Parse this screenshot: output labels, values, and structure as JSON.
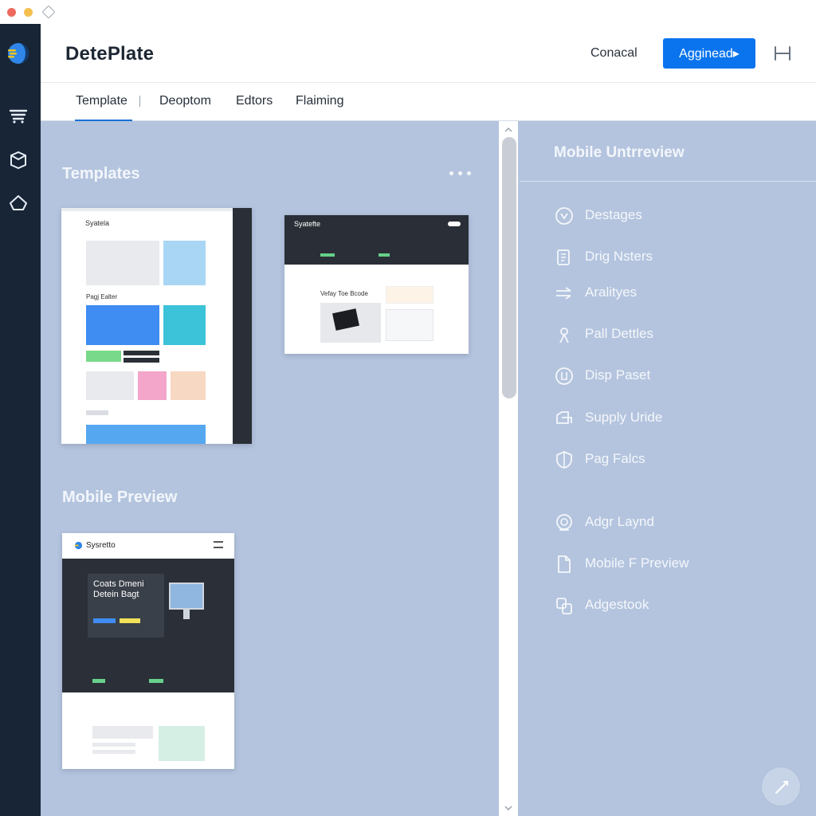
{
  "app": {
    "title": "DetePlate"
  },
  "header": {
    "cancel_label": "Conacal",
    "primary_label": "Agginead▸"
  },
  "tabs": [
    {
      "label": "Template",
      "active": true
    },
    {
      "label": "Deoptom"
    },
    {
      "label": "Edtors"
    },
    {
      "label": "Flaiming"
    }
  ],
  "templates": {
    "title": "Templates",
    "card1": {
      "brand": "Syatela",
      "section": "Pagj Ealter"
    },
    "card2": {
      "brand": "Syatefte",
      "headline": "Vefay Toe Bcode"
    }
  },
  "mobile_preview": {
    "title": "Mobile Preview",
    "brand": "Sysretto",
    "headline_1": "Coats Dmeni",
    "headline_2": "Detein Bagt"
  },
  "right_panel": {
    "title": "Mobile Untrreview",
    "items": [
      {
        "label": "Destages",
        "icon": "shield-icon"
      },
      {
        "label": "Drig Nsters",
        "icon": "document-icon"
      },
      {
        "label": "Aralityes",
        "icon": "arrows-icon"
      },
      {
        "label": "Pall Dettles",
        "icon": "person-icon"
      },
      {
        "label": "Disp Paset",
        "icon": "circle-icon"
      },
      {
        "label": "Supply Uride",
        "icon": "truck-icon"
      },
      {
        "label": "Pag Falcs",
        "icon": "shield-half-icon"
      },
      {
        "label": "Adgr Laynd",
        "icon": "badge-icon"
      },
      {
        "label": "Mobile F Preview",
        "icon": "file-icon"
      },
      {
        "label": "Adgestook",
        "icon": "copy-icon"
      }
    ]
  },
  "colors": {
    "accent": "#0a74ee",
    "rail": "#172536",
    "canvas": "#b4c4de"
  }
}
